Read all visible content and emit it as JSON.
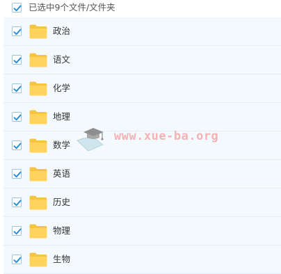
{
  "header": {
    "selection_text": "已选中9个文件/文件夹",
    "checked": true
  },
  "items": [
    {
      "name": "政治",
      "checked": true,
      "icon": "folder-icon"
    },
    {
      "name": "语文",
      "checked": true,
      "icon": "folder-icon"
    },
    {
      "name": "化学",
      "checked": true,
      "icon": "folder-icon"
    },
    {
      "name": "地理",
      "checked": true,
      "icon": "folder-icon"
    },
    {
      "name": "数学",
      "checked": true,
      "icon": "folder-icon"
    },
    {
      "name": "英语",
      "checked": true,
      "icon": "folder-icon"
    },
    {
      "name": "历史",
      "checked": true,
      "icon": "folder-icon"
    },
    {
      "name": "物理",
      "checked": true,
      "icon": "folder-icon"
    },
    {
      "name": "生物",
      "checked": true,
      "icon": "folder-icon"
    }
  ],
  "watermark": {
    "text": "www.xue-ba.org"
  },
  "colors": {
    "accent": "#2a8fd6",
    "row_background": "#f3f9fd",
    "folder": "#ffd35c"
  }
}
